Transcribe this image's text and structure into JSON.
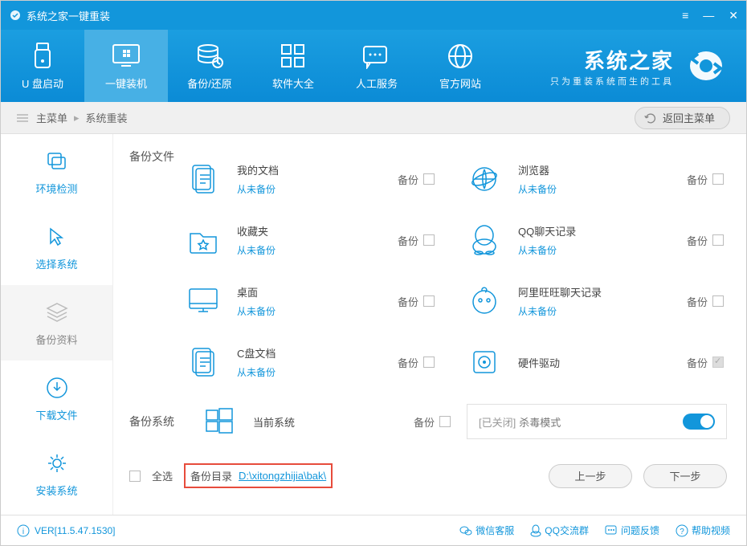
{
  "window": {
    "title": "系统之家一键重装"
  },
  "nav": {
    "items": [
      "U 盘启动",
      "一键装机",
      "备份/还原",
      "软件大全",
      "人工服务",
      "官方网站"
    ],
    "active_index": 1,
    "brand_title": "系统之家",
    "brand_sub": "只为重装系统而生的工具"
  },
  "breadcrumb": {
    "root": "主菜单",
    "current": "系统重装",
    "back": "返回主菜单"
  },
  "steps": [
    "环境检测",
    "选择系统",
    "备份资料",
    "下载文件",
    "安装系统"
  ],
  "steps_active_index": 2,
  "section": {
    "files": "备份文件",
    "system": "备份系统"
  },
  "backup_label": "备份",
  "status_unbackup": "从未备份",
  "left_files": [
    {
      "name": "我的文档"
    },
    {
      "name": "收藏夹"
    },
    {
      "name": "桌面"
    },
    {
      "name": "C盘文档"
    }
  ],
  "right_files": [
    {
      "name": "浏览器"
    },
    {
      "name": "QQ聊天记录"
    },
    {
      "name": "阿里旺旺聊天记录"
    },
    {
      "name": "硬件驱动",
      "locked": true
    }
  ],
  "system": {
    "current": "当前系统",
    "antivirus_closed": "[已关闭]",
    "antivirus_label": "杀毒模式"
  },
  "bottom": {
    "select_all": "全选",
    "path_label": "备份目录",
    "path": "D:\\xitongzhijia\\bak\\",
    "prev": "上一步",
    "next": "下一步"
  },
  "footer": {
    "version": "VER[11.5.47.1530]",
    "links": [
      "微信客服",
      "QQ交流群",
      "问题反馈",
      "帮助视频"
    ]
  }
}
